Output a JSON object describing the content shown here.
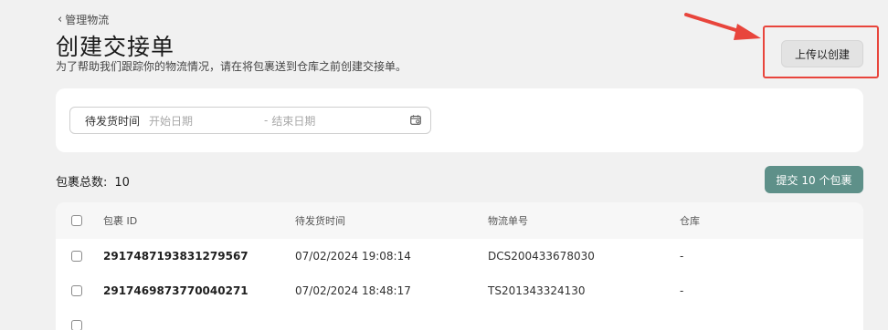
{
  "header": {
    "back_label": "管理物流",
    "title": "创建交接单",
    "subtitle": "为了帮助我们跟踪你的物流情况，请在将包裹送到仓库之前创建交接单。",
    "upload_button": "上传以创建"
  },
  "filter": {
    "label": "待发货时间",
    "start_placeholder": "开始日期",
    "separator": "-",
    "end_placeholder": "结束日期"
  },
  "summary": {
    "count_label": "包裹总数:",
    "count_value": "10",
    "submit_button": "提交 10 个包裹"
  },
  "table": {
    "columns": [
      "包裹 ID",
      "待发货时间",
      "物流单号",
      "仓库"
    ],
    "rows": [
      {
        "package_id": "2917487193831279567",
        "ship_time": "07/02/2024 19:08:14",
        "tracking": "DCS200433678030",
        "warehouse": "-"
      },
      {
        "package_id": "2917469873770040271",
        "ship_time": "07/02/2024 18:48:17",
        "tracking": "TS201343324130",
        "warehouse": "-"
      }
    ]
  },
  "colors": {
    "primary": "#5e9089",
    "highlight": "#e8453c",
    "background": "#f1f1f1"
  }
}
